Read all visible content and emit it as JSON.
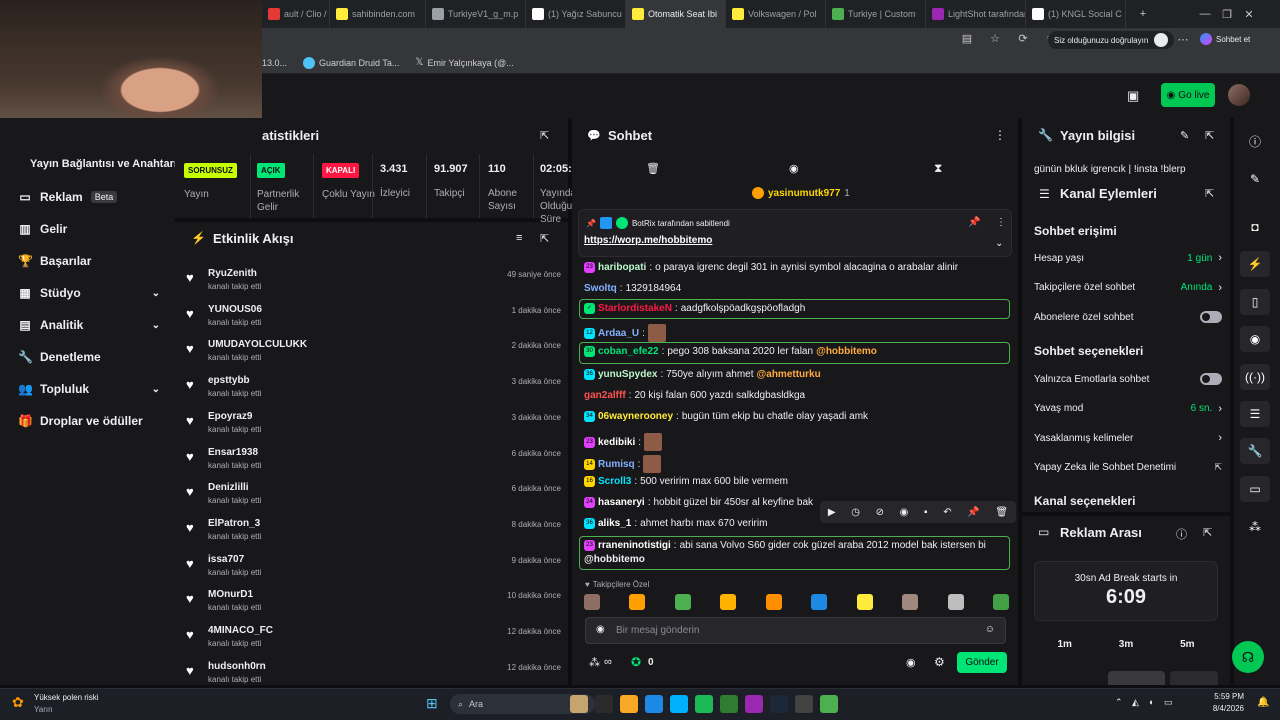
{
  "browser": {
    "tabs": [
      {
        "label": "ault / Clio / 1.9",
        "color": "#e53935"
      },
      {
        "label": "sahibinden.com",
        "color": "#ffeb3b"
      },
      {
        "label": "TurkiyeV1_g_m.p",
        "color": "#9aa0a6"
      },
      {
        "label": "(1) Yağız Sabuncu",
        "color": "#ffffff"
      },
      {
        "label": "Otomatik Seat Ibi",
        "color": "#ffeb3b"
      },
      {
        "label": "Volkswagen / Pol",
        "color": "#ffeb3b"
      },
      {
        "label": "Turkiye | Custom",
        "color": "#4caf50"
      },
      {
        "label": "LightShot tarafından",
        "color": "#9c27b0"
      },
      {
        "label": "(1) KNGL Social C",
        "color": "#ffffff"
      }
    ],
    "signin_label": "Siz olduğunuzu doğrulayın",
    "sohbet_et_label": "Sohbet et",
    "bookmarks": [
      "13.0...",
      "Guardian Druid Ta...",
      "Emir Yalçınkaya (@..."
    ]
  },
  "topbar": {
    "go_live_label": "Go live"
  },
  "nav": {
    "section_title": "Yayın Bağlantısı ve Anahtarı",
    "items": [
      {
        "label": "Reklam",
        "badge": "Beta",
        "icon": "monitor-icon"
      },
      {
        "label": "Gelir",
        "icon": "bar-chart-icon"
      },
      {
        "label": "Başarılar",
        "icon": "trophy-icon"
      },
      {
        "label": "Stüdyo",
        "icon": "grid-icon",
        "expandable": true
      },
      {
        "label": "Analitik",
        "icon": "analytics-icon",
        "expandable": true
      },
      {
        "label": "Denetleme",
        "icon": "wrench-icon"
      },
      {
        "label": "Topluluk",
        "icon": "people-icon",
        "expandable": true
      },
      {
        "label": "Droplar ve ödüller",
        "icon": "gift-icon"
      }
    ]
  },
  "stats": {
    "title": "atistikleri",
    "cols": [
      {
        "badge": "SORUNSUZ",
        "badge_color": "#c6ff00",
        "label": "Yayın"
      },
      {
        "badge": "AÇIK",
        "badge_color": "#00e676",
        "label": "Partnerlik Gelir"
      },
      {
        "badge": "KAPALI",
        "badge_color": "#ff1744",
        "label": "Çoklu Yayın"
      },
      {
        "value": "3.431",
        "label": "İzleyici"
      },
      {
        "value": "91.907",
        "label": "Takipçi"
      },
      {
        "value": "110",
        "label": "Abone Sayısı"
      },
      {
        "value": "02:05:",
        "label": "Yayında Olduğu Süre"
      }
    ]
  },
  "activity": {
    "title": "Etkinlik Akışı",
    "items": [
      {
        "user": "RyuZenith",
        "action": "kanalı takip etti",
        "time": "49 saniye önce"
      },
      {
        "user": "YUNOUS06",
        "action": "kanalı takip etti",
        "time": "1 dakika önce"
      },
      {
        "user": "UMUDAYOLCULUKK",
        "action": "kanalı takip etti",
        "time": "2 dakika önce"
      },
      {
        "user": "epsttybb",
        "action": "kanalı takip etti",
        "time": "3 dakika önce"
      },
      {
        "user": "Epoyraz9",
        "action": "kanalı takip etti",
        "time": "3 dakika önce"
      },
      {
        "user": "Ensar1938",
        "action": "kanalı takip etti",
        "time": "6 dakika önce"
      },
      {
        "user": "Denizlilli",
        "action": "kanalı takip etti",
        "time": "6 dakika önce"
      },
      {
        "user": "ElPatron_3",
        "action": "kanalı takip etti",
        "time": "8 dakika önce"
      },
      {
        "user": "issa707",
        "action": "kanalı takip etti",
        "time": "9 dakika önce"
      },
      {
        "user": "MOnurD1",
        "action": "kanalı takip etti",
        "time": "10 dakika önce"
      },
      {
        "user": "4MINACO_FC",
        "action": "kanalı takip etti",
        "time": "12 dakika önce"
      },
      {
        "user": "hudsonh0rn",
        "action": "kanalı takip etti",
        "time": "12 dakika önce"
      }
    ]
  },
  "chat": {
    "title": "Sohbet",
    "top_gifter": "yasinumutk977",
    "top_gifter_count": "1",
    "pinned_by": "BotRix tarafından sabitlendi",
    "pinned_link": "https://worp.me/hobbitemo",
    "messages": [
      {
        "badge": "23",
        "bcolor": "#e040fb",
        "user": "haribopati",
        "ucolor": "#b9f6ca",
        "text": "o paraya igrenc degil 301 in aynisi symbol alacagina o arabalar alinir"
      },
      {
        "user": "Swoltq",
        "ucolor": "#82b1ff",
        "text": "1329184964"
      },
      {
        "badge": "✓",
        "bcolor": "#00e676",
        "user": "StarlordistakeN",
        "ucolor": "#ff1744",
        "text": "aadgfkolşpöadkgşpöofladgh",
        "highlight": true
      },
      {
        "badge": "12",
        "bcolor": "#00e5ff",
        "user": "Ardaa_U",
        "ucolor": "#82b1ff",
        "text": "",
        "emote": true
      },
      {
        "badge": "30",
        "bcolor": "#00e676",
        "user": "coban_efe22",
        "ucolor": "#00e676",
        "text": "pego 308 baksana 2020 ler falan",
        "mention": "@hobbitemo",
        "highlight": true
      },
      {
        "badge": "36",
        "bcolor": "#00e5ff",
        "user": "yunuSpydex",
        "ucolor": "#b9f6ca",
        "text": "750ye alıyım ahmet",
        "mention": "@ahmetturku"
      },
      {
        "user": "gan2alfff",
        "ucolor": "#ff5252",
        "text": "20 kişi falan 600 yazdı salkdgbasldkga"
      },
      {
        "badge": "34",
        "bcolor": "#00e5ff",
        "user": "06waynerooney",
        "ucolor": "#ffeb3b",
        "text": "bugün tüm ekip bu chatle olay yaşadi amk"
      },
      {
        "badge": "23",
        "bcolor": "#e040fb",
        "user": "kedibiki",
        "ucolor": "#ffffff",
        "text": "",
        "emote": true
      },
      {
        "badge": "14",
        "bcolor": "#ffd600",
        "user": "Rumisq",
        "ucolor": "#82b1ff",
        "text": "",
        "emote": true
      },
      {
        "badge": "16",
        "bcolor": "#ffd600",
        "user": "Scroll3",
        "ucolor": "#00e5ff",
        "text": "500 veririm max 600 bile vermem"
      },
      {
        "badge": "24",
        "bcolor": "#e040fb",
        "user": "hasaneryi",
        "ucolor": "#ffffff",
        "text": "hobbit güzel bir 450sr al keyfine bak"
      },
      {
        "badge": "36",
        "bcolor": "#00e5ff",
        "user": "aliks_1",
        "ucolor": "#ffffff",
        "text": "ahmet harbı max 670 veririm"
      },
      {
        "badge": "23",
        "bcolor": "#e040fb",
        "user": "rraneninotistigi",
        "ucolor": "#ffffff",
        "text": "abi sana Volvo S60 gider cok güzel araba 2012 model bak istersen bi",
        "mention": "@hobbitemo",
        "highlight": true
      }
    ],
    "followers_only_label": "Takipçilere Özel",
    "input_placeholder": "Bir mesaj gönderin",
    "points": "0",
    "send_label": "Gönder"
  },
  "stream_info": {
    "title": "Yayın bilgisi",
    "stream_title": "günün bkluk igrencık | !insta !blerp"
  },
  "channel_actions": {
    "title": "Kanal Eylemleri",
    "chat_access_title": "Sohbet erişimi",
    "rows": [
      {
        "label": "Hesap yaşı",
        "value": "1 gün"
      },
      {
        "label": "Takipçilere özel sohbet",
        "value": "Anında"
      },
      {
        "label": "Abonelere özel sohbet",
        "toggle": true
      }
    ],
    "chat_options_title": "Sohbet seçenekleri",
    "rows2": [
      {
        "label": "Yalnızca Emotlarla sohbet",
        "toggle": true
      },
      {
        "label": "Yavaş mod",
        "value": "6 sn."
      },
      {
        "label": "Yasaklanmış kelimeler",
        "value": ""
      },
      {
        "label": "Yapay Zeka ile Sohbet Denetimi",
        "external": true
      }
    ],
    "channel_options_title": "Kanal seçenekleri"
  },
  "ad_break": {
    "title": "Reklam Arası",
    "starts_in_label": "30sn Ad Break starts in",
    "countdown": "6:09",
    "options": [
      "1m",
      "3m",
      "5m"
    ]
  },
  "taskbar": {
    "weather_title": "Yüksek polen riski",
    "weather_sub": "Yarın",
    "search_label": "Ara",
    "time": "5:59 PM",
    "date": "8/4/2026"
  }
}
